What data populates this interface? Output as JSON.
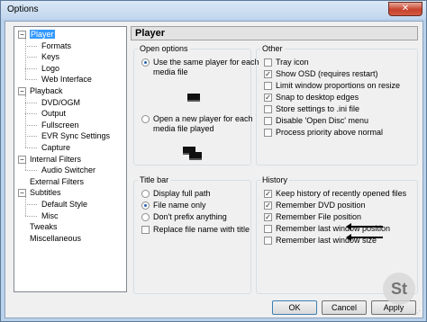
{
  "window": {
    "title": "Options",
    "close_glyph": "✕"
  },
  "tree": {
    "items": [
      {
        "label": "Player",
        "level": 0,
        "expander": "−",
        "selected": true
      },
      {
        "label": "Formats",
        "level": 1
      },
      {
        "label": "Keys",
        "level": 1
      },
      {
        "label": "Logo",
        "level": 1
      },
      {
        "label": "Web Interface",
        "level": 1
      },
      {
        "label": "Playback",
        "level": 0,
        "expander": "−"
      },
      {
        "label": "DVD/OGM",
        "level": 1
      },
      {
        "label": "Output",
        "level": 1
      },
      {
        "label": "Fullscreen",
        "level": 1
      },
      {
        "label": "EVR Sync Settings",
        "level": 1
      },
      {
        "label": "Capture",
        "level": 1
      },
      {
        "label": "Internal Filters",
        "level": 0,
        "expander": "−"
      },
      {
        "label": "Audio Switcher",
        "level": 1
      },
      {
        "label": "External Filters",
        "level": 0
      },
      {
        "label": "Subtitles",
        "level": 0,
        "expander": "−"
      },
      {
        "label": "Default Style",
        "level": 1
      },
      {
        "label": "Misc",
        "level": 1
      },
      {
        "label": "Tweaks",
        "level": 0
      },
      {
        "label": "Miscellaneous",
        "level": 0
      }
    ]
  },
  "page": {
    "title": "Player"
  },
  "open_options": {
    "title": "Open options",
    "same_player_line1": "Use the same player for each",
    "same_player_line2": "media file",
    "same_player_checked": true,
    "new_player_line1": "Open a new player for each",
    "new_player_line2": "media file played",
    "new_player_checked": false
  },
  "other": {
    "title": "Other",
    "items": [
      {
        "label": "Tray icon",
        "checked": false
      },
      {
        "label": "Show OSD (requires restart)",
        "checked": true
      },
      {
        "label": "Limit window proportions on resize",
        "checked": false
      },
      {
        "label": "Snap to desktop edges",
        "checked": true
      },
      {
        "label": "Store settings to .ini file",
        "checked": false
      },
      {
        "label": "Disable 'Open Disc' menu",
        "checked": false
      },
      {
        "label": "Process priority above normal",
        "checked": false
      }
    ]
  },
  "title_bar": {
    "title": "Title bar",
    "radios": [
      {
        "label": "Display full path",
        "checked": false
      },
      {
        "label": "File name only",
        "checked": true
      },
      {
        "label": "Don't prefix anything",
        "checked": false
      }
    ],
    "replace_label": "Replace file name with title",
    "replace_checked": false
  },
  "history": {
    "title": "History",
    "items": [
      {
        "label": "Keep history of recently opened files",
        "checked": true
      },
      {
        "label": "Remember DVD position",
        "checked": true
      },
      {
        "label": "Remember File position",
        "checked": true
      },
      {
        "label": "Remember last window position",
        "checked": false
      },
      {
        "label": "Remember last window size",
        "checked": false
      }
    ]
  },
  "buttons": {
    "ok": "OK",
    "cancel": "Cancel",
    "apply": "Apply"
  },
  "watermark": "St",
  "watermark_url": "www.sumtips.com",
  "check_glyph": "✓",
  "icons": {
    "close": "close-icon",
    "monitor": "monitor-icon",
    "arrow": "arrow-left-icon"
  }
}
